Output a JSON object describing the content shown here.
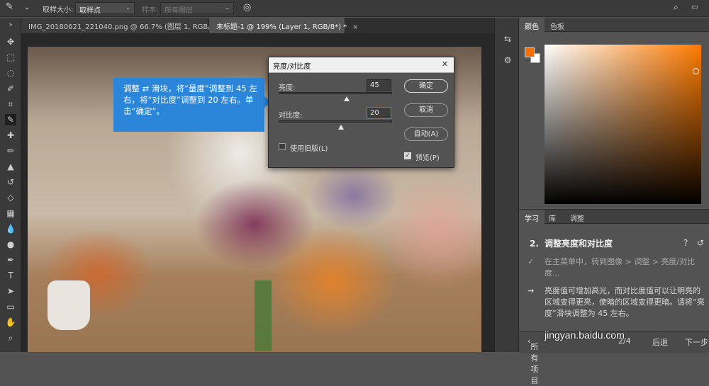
{
  "options_bar": {
    "sample_size_label": "取样大小:",
    "sample_size_value": "取样点",
    "sample_label": "样本:",
    "sample_value": "所有图层"
  },
  "tabs": [
    {
      "label": "IMG_20180621_221040.png @ 66.7% (图层 1, RGB/8)",
      "close": "×"
    },
    {
      "label": "未标题-1 @ 199% (Layer 1, RGB/8*) *",
      "close": "×"
    }
  ],
  "dialog": {
    "title": "亮度/对比度",
    "close": "✕",
    "brightness_label": "亮度:",
    "brightness_value": "45",
    "brightness_fraction": 0.6,
    "contrast_label": "对比度:",
    "contrast_value": "20",
    "contrast_fraction": 0.55,
    "legacy_label": "使用旧版(L)",
    "ok": "确定",
    "cancel": "取消",
    "auto": "自动(A)",
    "preview_label": "预览(P)"
  },
  "callout": {
    "text_a": "调整",
    "icon": "⇄",
    "text_b": "滑块，将“量度”调整到 45 左右，将“对比度”调整到 20 左右。单击“确定”。"
  },
  "color_panel": {
    "tab_color": "颜色",
    "tab_swatches": "色板",
    "foreground": "#f26e07",
    "background": "#ffffff"
  },
  "learn_panel": {
    "tab_learn": "学习",
    "tab_library": "库",
    "tab_adjust": "调整",
    "step_number": "2.",
    "step_title": "调整亮度和对比度",
    "item1": "在主菜单中，转到图像 > 调整 > 亮度/对比度...",
    "item2": "亮度值可增加高光，而对比度值可以让明亮的区域变得更亮，使暗的区域变得更暗。请将“亮度”滑块调整为 45 左右。",
    "footer_all": "所有项目",
    "footer_page": "2/4",
    "footer_back": "后退",
    "footer_next": "下一步"
  },
  "watermark": "jingyan.baidu.com"
}
